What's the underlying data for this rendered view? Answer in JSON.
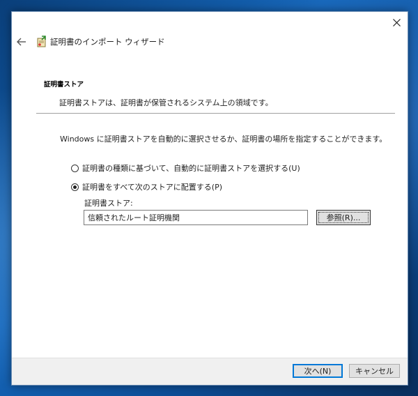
{
  "window": {
    "title": "証明書のインポート ウィザード",
    "close_icon": "close-icon",
    "back_icon": "back-arrow-icon",
    "app_icon": "certificate-import-icon"
  },
  "page": {
    "heading": "証明書ストア",
    "description": "証明書ストアは、証明書が保管されるシステム上の領域です。",
    "instruction": "Windows に証明書ストアを自動的に選択させるか、証明書の場所を指定することができます。"
  },
  "options": {
    "auto": {
      "label": "証明書の種類に基づいて、自動的に証明書ストアを選択する(U)",
      "selected": false
    },
    "manual": {
      "label": "証明書をすべて次のストアに配置する(P)",
      "selected": true
    }
  },
  "store": {
    "label": "証明書ストア:",
    "value": "信頼されたルート証明機関",
    "browse_label": "参照(R)..."
  },
  "footer": {
    "next_label": "次へ(N)",
    "cancel_label": "キャンセル"
  },
  "colors": {
    "accent": "#0078d7",
    "window_bg": "#ffffff",
    "footer_bg": "#f0f0f0"
  }
}
